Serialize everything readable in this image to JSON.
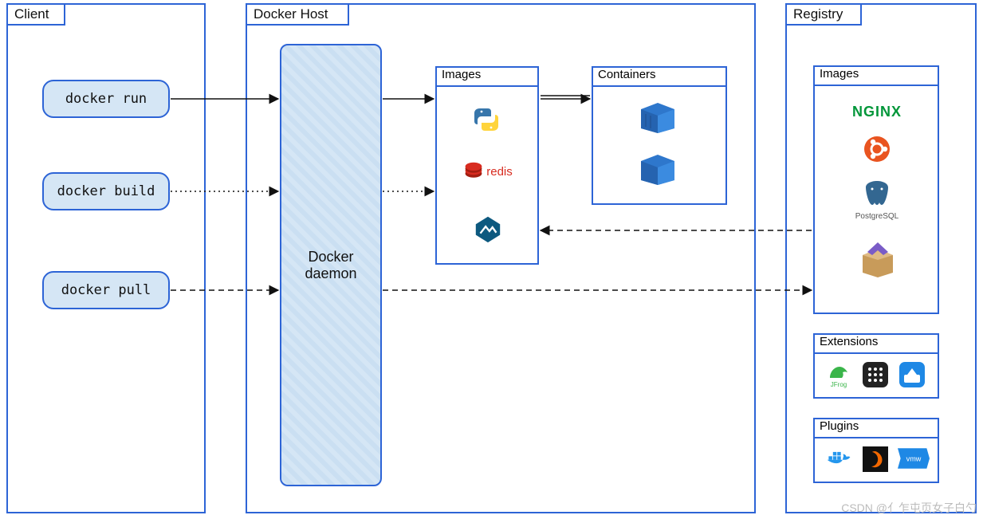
{
  "diagram": {
    "kind": "Docker architecture overview",
    "arrows": [
      {
        "from": "client docker run",
        "to": "docker daemon",
        "style": "solid"
      },
      {
        "from": "client docker build",
        "to": "docker daemon",
        "style": "dotted"
      },
      {
        "from": "client docker pull",
        "to": "docker daemon",
        "style": "dashed"
      },
      {
        "from": "docker daemon",
        "to": "host images",
        "style": "solid",
        "context": "run"
      },
      {
        "from": "docker daemon",
        "to": "host images",
        "style": "dotted",
        "context": "build"
      },
      {
        "from": "docker daemon",
        "to": "registry images",
        "style": "dashed",
        "context": "pull"
      },
      {
        "from": "host images",
        "to": "host containers",
        "style": "solid double-head"
      },
      {
        "from": "registry images",
        "to": "host images",
        "style": "dashed"
      }
    ]
  },
  "client": {
    "title": "Client",
    "commands": {
      "run": "docker run",
      "build": "docker build",
      "pull": "docker pull"
    }
  },
  "host": {
    "title": "Docker Host",
    "daemon_label": "Docker daemon",
    "images": {
      "title": "Images",
      "items": [
        {
          "name": "python-icon",
          "label": "Python"
        },
        {
          "name": "redis-icon",
          "label": "redis"
        },
        {
          "name": "alpine-icon",
          "label": "Alpine"
        }
      ]
    },
    "containers": {
      "title": "Containers",
      "items": [
        {
          "name": "container-icon",
          "label": "container"
        },
        {
          "name": "container-icon",
          "label": "container"
        }
      ]
    }
  },
  "registry": {
    "title": "Registry",
    "images": {
      "title": "Images",
      "items": [
        {
          "name": "nginx-icon",
          "label": "NGINX"
        },
        {
          "name": "ubuntu-icon",
          "label": "Ubuntu"
        },
        {
          "name": "postgres-icon",
          "label": "PostgreSQL"
        },
        {
          "name": "box-icon",
          "label": "package"
        }
      ]
    },
    "extensions": {
      "title": "Extensions",
      "items": [
        {
          "name": "jfrog-icon",
          "label": "JFrog"
        },
        {
          "name": "grid-icon",
          "label": "app"
        },
        {
          "name": "disk-icon",
          "label": "volume"
        }
      ]
    },
    "plugins": {
      "title": "Plugins",
      "items": [
        {
          "name": "docker-icon",
          "label": "Docker"
        },
        {
          "name": "grafana-icon",
          "label": "Grafana"
        },
        {
          "name": "vmware-icon",
          "label": "vmw"
        }
      ]
    }
  },
  "watermark": "CSDN @亻乍屯页女子白勺"
}
